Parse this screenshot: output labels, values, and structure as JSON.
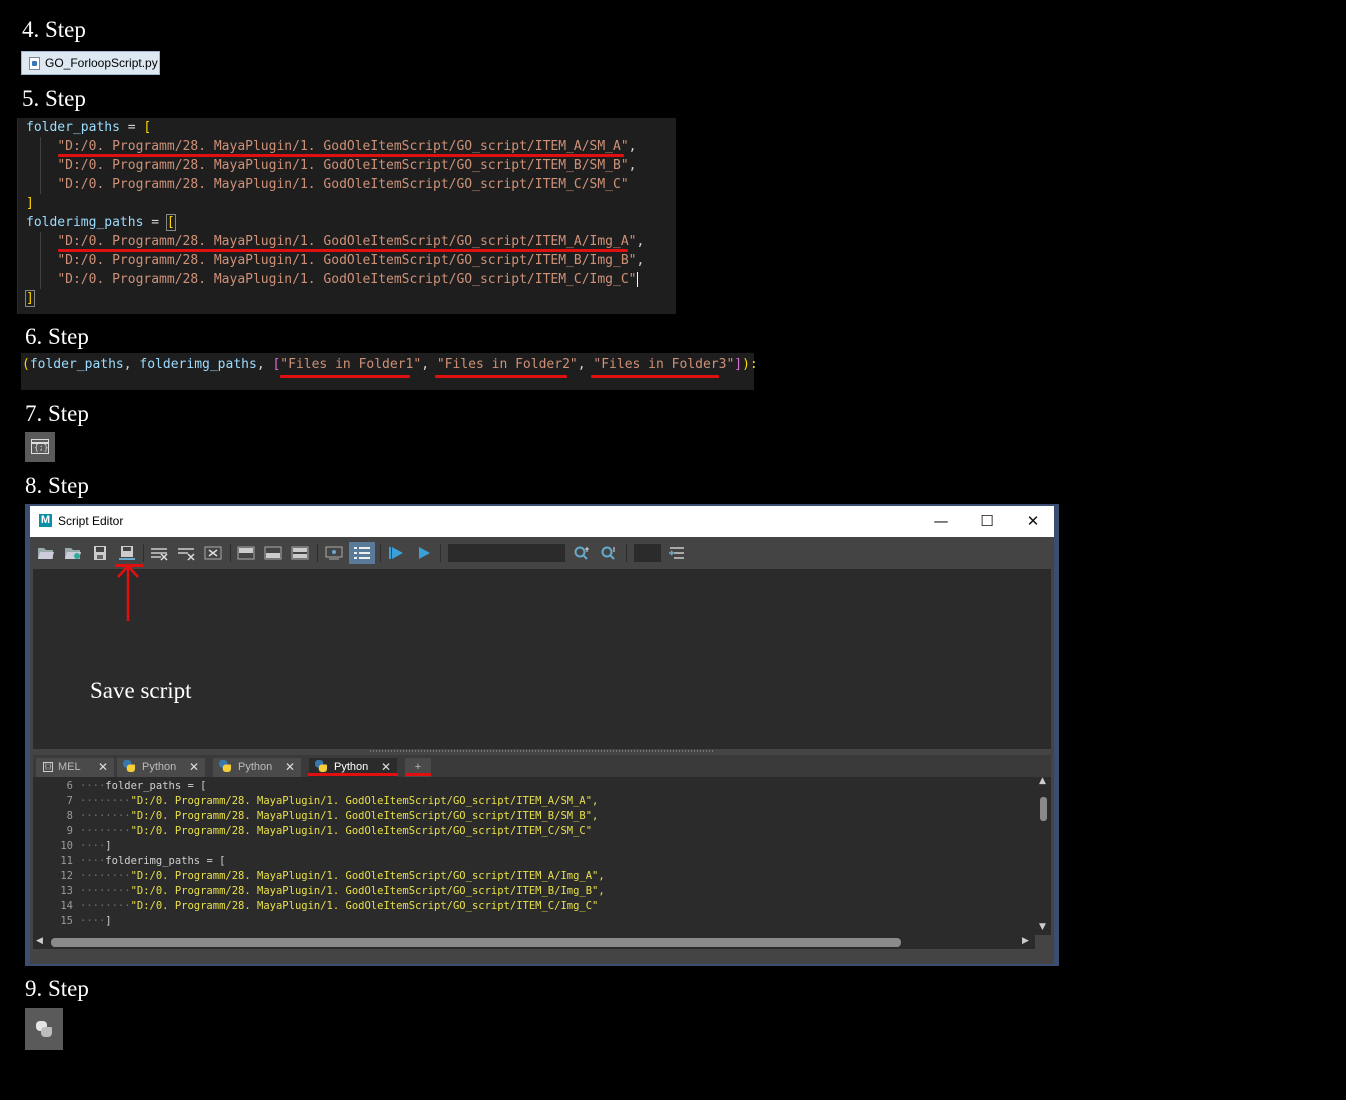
{
  "steps": {
    "s4": "4. Step",
    "s5": "5. Step",
    "s6": "6. Step",
    "s7": "7. Step",
    "s8": "8. Step",
    "s9": "9. Step"
  },
  "file_button": {
    "label": "GO_ForloopScript.py",
    "icon": "python-file-icon"
  },
  "code5": {
    "l1_var": "folder_paths",
    "l1_op": " = ",
    "l1_br": "[",
    "l2": "\"D:/0. Programm/28. MayaPlugin/1. GodOleItemScript/GO_script/ITEM_A/SM_A\"",
    "l3": "\"D:/0. Programm/28. MayaPlugin/1. GodOleItemScript/GO_script/ITEM_B/SM_B\"",
    "l4": "\"D:/0. Programm/28. MayaPlugin/1. GodOleItemScript/GO_script/ITEM_C/SM_C\"",
    "l5": "]",
    "l6_var": "folderimg_paths",
    "l6_op": " = ",
    "l6_br": "[",
    "l7": "\"D:/0. Programm/28. MayaPlugin/1. GodOleItemScript/GO_script/ITEM_A/Img_A\"",
    "l8": "\"D:/0. Programm/28. MayaPlugin/1. GodOleItemScript/GO_script/ITEM_B/Img_B\"",
    "l9": "\"D:/0. Programm/28. MayaPlugin/1. GodOleItemScript/GO_script/ITEM_C/Img_C\"",
    "l10": "]",
    "comma": ","
  },
  "code6": {
    "open": "(",
    "v1": "folder_paths",
    "sep": ", ",
    "v2": "folderimg_paths",
    "lb": "[",
    "s1": "\"Files in Folder1\"",
    "s2": "\"Files in Folder2\"",
    "s3": "\"Files in Folder3\"",
    "rb": "]",
    "close": "):"
  },
  "icon7": {
    "name": "script-editor-icon",
    "glyph": "{;}"
  },
  "icon9": {
    "name": "python-logo-icon"
  },
  "editor": {
    "title": "Script Editor",
    "logo": "M",
    "minimize": "—",
    "maximize": "☐",
    "close": "✕",
    "annotation": "Save script",
    "tabs": [
      {
        "label": "MEL",
        "close": "✕"
      },
      {
        "label": "Python",
        "close": "✕"
      },
      {
        "label": "Python",
        "close": "✕"
      },
      {
        "label": "Python",
        "close": "✕"
      },
      {
        "label": "+"
      }
    ],
    "lines": [
      {
        "n": "6",
        "dots": "····",
        "code": "folder_paths = [",
        "str": ""
      },
      {
        "n": "7",
        "dots": "········",
        "code": "",
        "str": "\"D:/0. Programm/28. MayaPlugin/1. GodOleItemScript/GO_script/ITEM_A/SM_A\","
      },
      {
        "n": "8",
        "dots": "········",
        "code": "",
        "str": "\"D:/0. Programm/28. MayaPlugin/1. GodOleItemScript/GO_script/ITEM_B/SM_B\","
      },
      {
        "n": "9",
        "dots": "········",
        "code": "",
        "str": "\"D:/0. Programm/28. MayaPlugin/1. GodOleItemScript/GO_script/ITEM_C/SM_C\""
      },
      {
        "n": "10",
        "dots": "····",
        "code": "]",
        "str": ""
      },
      {
        "n": "11",
        "dots": "····",
        "code": "folderimg_paths = [",
        "str": ""
      },
      {
        "n": "12",
        "dots": "········",
        "code": "",
        "str": "\"D:/0. Programm/28. MayaPlugin/1. GodOleItemScript/GO_script/ITEM_A/Img_A\","
      },
      {
        "n": "13",
        "dots": "········",
        "code": "",
        "str": "\"D:/0. Programm/28. MayaPlugin/1. GodOleItemScript/GO_script/ITEM_B/Img_B\","
      },
      {
        "n": "14",
        "dots": "········",
        "code": "",
        "str": "\"D:/0. Programm/28. MayaPlugin/1. GodOleItemScript/GO_script/ITEM_C/Img_C\""
      },
      {
        "n": "15",
        "dots": "····",
        "code": "]",
        "str": ""
      }
    ],
    "scroll_left": "◀",
    "scroll_right": "▶",
    "scroll_up": "▲",
    "scroll_down": "▼"
  },
  "colors": {
    "highlight": "#e01010",
    "accent": "#0a8fa8",
    "string": "#ce9178"
  }
}
